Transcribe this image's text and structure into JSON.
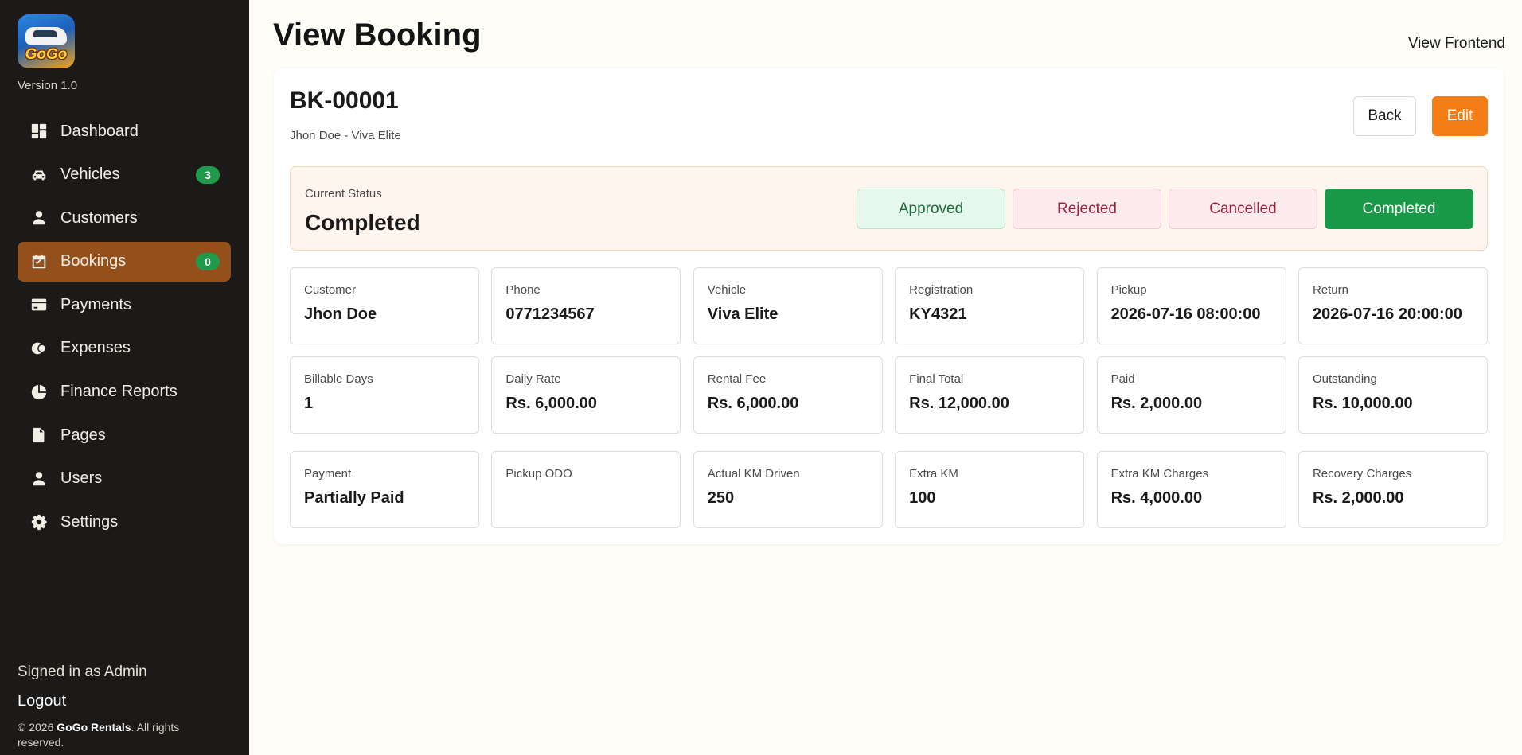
{
  "sidebar": {
    "logo_text": "GoGo",
    "version": "Version 1.0",
    "items": [
      {
        "label": "Dashboard",
        "icon": "dashboard-icon"
      },
      {
        "label": "Vehicles",
        "icon": "car-icon",
        "badge": "3"
      },
      {
        "label": "Customers",
        "icon": "user-icon"
      },
      {
        "label": "Bookings",
        "icon": "calendar-check-icon",
        "badge": "0",
        "active": true
      },
      {
        "label": "Payments",
        "icon": "credit-card-icon"
      },
      {
        "label": "Expenses",
        "icon": "coins-icon"
      },
      {
        "label": "Finance Reports",
        "icon": "pie-chart-icon"
      },
      {
        "label": "Pages",
        "icon": "file-icon"
      },
      {
        "label": "Users",
        "icon": "user-icon"
      },
      {
        "label": "Settings",
        "icon": "gear-icon"
      }
    ],
    "signed_in": "Signed in as Admin",
    "logout": "Logout",
    "copyright_prefix": "© 2026",
    "copyright_brand": "GoGo Rentals",
    "copyright_suffix": ". All rights reserved."
  },
  "header": {
    "title": "View Booking",
    "view_frontend": "View Frontend"
  },
  "booking": {
    "id": "BK-00001",
    "subtitle": "Jhon Doe - Viva Elite",
    "back_label": "Back",
    "edit_label": "Edit"
  },
  "status": {
    "label": "Current Status",
    "value": "Completed",
    "buttons": {
      "approved": "Approved",
      "rejected": "Rejected",
      "cancelled": "Cancelled",
      "completed": "Completed"
    }
  },
  "details": {
    "row1": [
      {
        "label": "Customer",
        "value": "Jhon Doe"
      },
      {
        "label": "Phone",
        "value": "0771234567"
      },
      {
        "label": "Vehicle",
        "value": "Viva Elite"
      },
      {
        "label": "Registration",
        "value": "KY4321"
      },
      {
        "label": "Pickup",
        "value": "2026-07-16 08:00:00"
      },
      {
        "label": "Return",
        "value": "2026-07-16 20:00:00"
      }
    ],
    "row2": [
      {
        "label": "Billable Days",
        "value": "1"
      },
      {
        "label": "Daily Rate",
        "value": "Rs. 6,000.00"
      },
      {
        "label": "Rental Fee",
        "value": "Rs. 6,000.00"
      },
      {
        "label": "Final Total",
        "value": "Rs. 12,000.00"
      },
      {
        "label": "Paid",
        "value": "Rs. 2,000.00"
      },
      {
        "label": "Outstanding",
        "value": "Rs. 10,000.00"
      }
    ],
    "row3": [
      {
        "label": "Payment",
        "value": "Partially Paid"
      },
      {
        "label": "Pickup ODO",
        "value": ""
      },
      {
        "label": "Actual KM Driven",
        "value": "250"
      },
      {
        "label": "Extra KM",
        "value": "100"
      },
      {
        "label": "Extra KM Charges",
        "value": "Rs. 4,000.00"
      },
      {
        "label": "Recovery Charges",
        "value": "Rs. 2,000.00"
      }
    ]
  },
  "colors": {
    "sidebar_bg": "#1b1a19",
    "active_nav": "#93501a",
    "badge": "#1f9a4b",
    "edit_button": "#f57d16",
    "completed_button": "#1a9a48"
  }
}
